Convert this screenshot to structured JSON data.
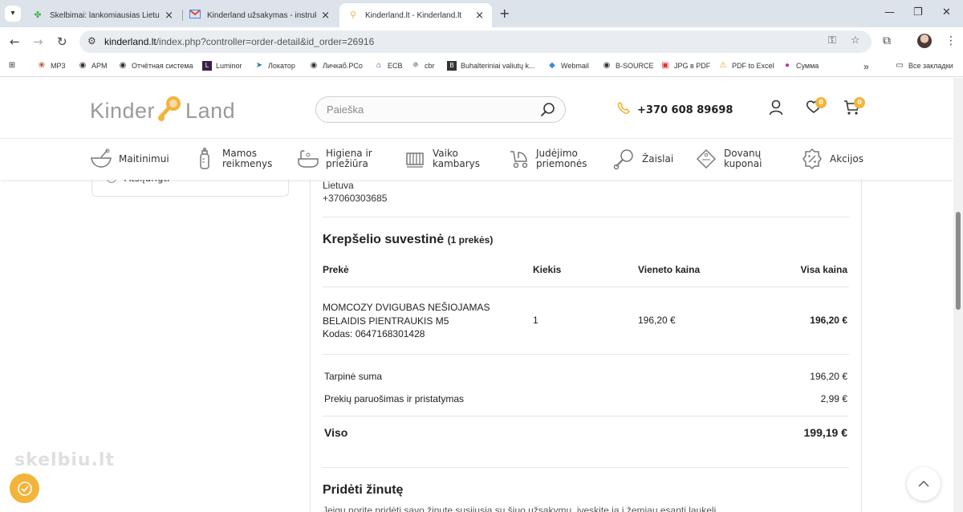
{
  "browser": {
    "tabs": [
      {
        "title": "Skelbimai: lankomiausias Lietuvoje",
        "active": false
      },
      {
        "title": "Kinderland užsakymas - instrukcija",
        "active": false
      },
      {
        "title": "Kinderland.lt - Kinderland.lt",
        "active": true
      }
    ],
    "url_host": "kinderland.lt",
    "url_path": "/index.php?controller=order-detail&id_order=26916",
    "bookmarks": [
      "MP3",
      "APM",
      "Отчётная система",
      "Luminor",
      "Локатор",
      "Личкаб.РСо",
      "ECB",
      "cbr",
      "Buhalteriniai valiutų k...",
      "Webmail",
      "B-SOURCE",
      "JPG в PDF",
      "PDF to Excel",
      "Сумма"
    ],
    "all_bookmarks": "Все закладки"
  },
  "header": {
    "logo_left": "Kinder",
    "logo_right": "Land",
    "search_placeholder": "Paieška",
    "phone": "+370 608 89698",
    "wishlist_count": "0",
    "cart_count": "0"
  },
  "categories": [
    {
      "l1": "Maitinimui",
      "l2": ""
    },
    {
      "l1": "Mamos",
      "l2": "reikmenys"
    },
    {
      "l1": "Higiena ir",
      "l2": "priežiūra"
    },
    {
      "l1": "Vaiko",
      "l2": "kambarys"
    },
    {
      "l1": "Judėjimo",
      "l2": "priemonės"
    },
    {
      "l1": "Žaislai",
      "l2": ""
    },
    {
      "l1": "Dovanų",
      "l2": "kuponai"
    },
    {
      "l1": "Akcijos",
      "l2": ""
    }
  ],
  "left_option": "Atsiįungti",
  "address": {
    "country": "Lietuva",
    "phone": "+37060303685"
  },
  "summary": {
    "title": "Krepšelio suvestinė",
    "count": "(1 prekės)",
    "headers": {
      "product": "Prekė",
      "qty": "Kiekis",
      "unit": "Vieneto kaina",
      "total": "Visa kaina"
    },
    "item": {
      "name1": "MOMCOZY DVIGUBAS NEŠIOJAMAS",
      "name2": "BELAIDIS PIENTRAUKIS M5",
      "code": "Kodas: 0647168301428",
      "qty": "1",
      "unit_price": "196,20 €",
      "total_price": "196,20 €"
    },
    "subtotal_label": "Tarpinė suma",
    "subtotal_value": "196,20 €",
    "shipping_label": "Prekių paruošimas ir pristatymas",
    "shipping_value": "2,99 €",
    "grand_label": "Viso",
    "grand_value": "199,19 €"
  },
  "message": {
    "title": "Pridėti žinutę",
    "text": "Jeigu norite pridėti savo žinutę susijusią su šiuo užsakymu, įveskite ją į žemiau esantį laukelį."
  },
  "watermark": "skelbiu.lt",
  "colors": {
    "accent": "#f3b43b",
    "text": "#222222"
  }
}
